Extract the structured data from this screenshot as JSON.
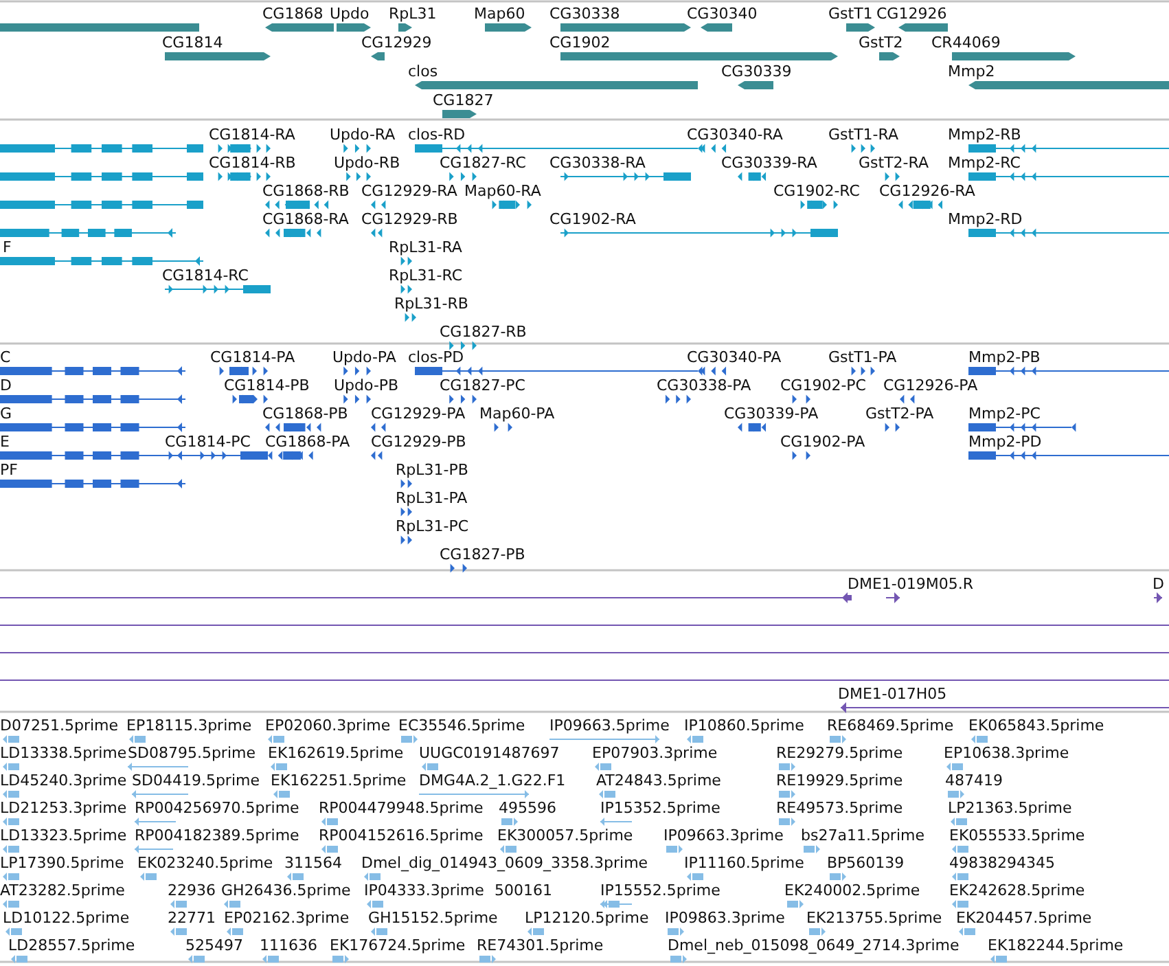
{
  "tracks": [
    {
      "kind": "gene",
      "features": [
        {
          "kind": "partial"
        },
        {
          "label": "CG1868",
          "reverse": true
        },
        {
          "label": "Updo",
          "reverse": false
        },
        {
          "label": "RpL31",
          "reverse": false
        },
        {
          "label": "Map60",
          "reverse": false
        },
        {
          "label": "CG30338",
          "reverse": false
        },
        {
          "label": "CG30340",
          "reverse": true
        },
        {
          "label": "GstT1",
          "reverse": false
        },
        {
          "label": "CG12926",
          "reverse": true
        },
        {
          "label": "CG1814",
          "reverse": false
        },
        {
          "label": "CG12929",
          "reverse": true
        },
        {
          "label": "CG1902",
          "reverse": false
        },
        {
          "label": "GstT2",
          "reverse": false
        },
        {
          "label": "CR44069",
          "reverse": false
        },
        {
          "label": "clos",
          "reverse": true
        },
        {
          "label": "CG30339",
          "reverse": true
        },
        {
          "label": "Mmp2",
          "reverse": true
        },
        {
          "label": "CG1827",
          "reverse": false
        }
      ]
    },
    {
      "kind": "transcript",
      "features": [
        {
          "kind": "partial"
        },
        {
          "label": "CG1814-RA",
          "reverse": false
        },
        {
          "label": "Updo-RA",
          "reverse": false
        },
        {
          "label": "clos-RD",
          "reverse": true
        },
        {
          "label": "CG30340-RA",
          "reverse": true
        },
        {
          "label": "GstT1-RA",
          "reverse": false
        },
        {
          "label": "Mmp2-RB",
          "reverse": true
        },
        {
          "kind": "partial"
        },
        {
          "label": "CG1814-RB",
          "reverse": false
        },
        {
          "label": "Updo-RB",
          "reverse": false
        },
        {
          "label": "CG1827-RC",
          "reverse": false
        },
        {
          "label": "CG30338-RA",
          "reverse": false
        },
        {
          "label": "CG30339-RA",
          "reverse": true
        },
        {
          "label": "GstT2-RA",
          "reverse": false
        },
        {
          "label": "Mmp2-RC",
          "reverse": true
        },
        {
          "kind": "partial"
        },
        {
          "label": "CG1868-RB",
          "reverse": true
        },
        {
          "label": "CG12929-RA",
          "reverse": true
        },
        {
          "label": "Map60-RA",
          "reverse": false
        },
        {
          "label": "CG1902-RC",
          "reverse": false
        },
        {
          "label": "CG12926-RA",
          "reverse": true
        },
        {
          "reverse": true
        },
        {
          "label": "CG1868-RA",
          "reverse": true
        },
        {
          "label": "CG12929-RB",
          "reverse": true
        },
        {
          "label": "CG1902-RA",
          "reverse": false
        },
        {
          "label": "Mmp2-RD",
          "reverse": true
        },
        {
          "label": "F",
          "reverse": true
        },
        {
          "label": "RpL31-RA",
          "reverse": false
        },
        {
          "label": "CG1814-RC",
          "reverse": false
        },
        {
          "label": "RpL31-RC",
          "reverse": false
        },
        {
          "label": "RpL31-RB",
          "reverse": false
        },
        {
          "label": "CG1827-RB",
          "reverse": false
        }
      ]
    },
    {
      "kind": "protein",
      "features": [
        {
          "label": "C",
          "reverse": true
        },
        {
          "label": "CG1814-PA",
          "reverse": false
        },
        {
          "label": "Updo-PA",
          "reverse": false
        },
        {
          "label": "clos-PD",
          "reverse": true
        },
        {
          "label": "CG30340-PA",
          "reverse": true
        },
        {
          "label": "GstT1-PA",
          "reverse": false
        },
        {
          "label": "Mmp2-PB",
          "reverse": true
        },
        {
          "label": "D",
          "reverse": true
        },
        {
          "label": "CG1814-PB",
          "reverse": false
        },
        {
          "label": "Updo-PB",
          "reverse": false
        },
        {
          "label": "CG1827-PC",
          "reverse": false
        },
        {
          "label": "CG30338-PA",
          "reverse": false
        },
        {
          "label": "CG1902-PC",
          "reverse": false
        },
        {
          "label": "CG12926-PA",
          "reverse": true
        },
        {
          "label": "G",
          "reverse": true
        },
        {
          "label": "CG1868-PB",
          "reverse": true
        },
        {
          "label": "CG12929-PA",
          "reverse": true
        },
        {
          "label": "Map60-PA",
          "reverse": false
        },
        {
          "label": "CG30339-PA",
          "reverse": true
        },
        {
          "label": "GstT2-PA",
          "reverse": false
        },
        {
          "label": "Mmp2-PC",
          "reverse": true
        },
        {
          "label": "E",
          "reverse": true
        },
        {
          "label": "CG1814-PC",
          "reverse": false
        },
        {
          "label": "CG1868-PA",
          "reverse": true
        },
        {
          "label": "CG12929-PB",
          "reverse": true
        },
        {
          "label": "CG1902-PA",
          "reverse": false
        },
        {
          "label": "Mmp2-PD",
          "reverse": true
        },
        {
          "label": "PF",
          "reverse": true
        },
        {
          "label": "RpL31-PB",
          "reverse": false
        },
        {
          "label": "RpL31-PA",
          "reverse": false
        },
        {
          "label": "RpL31-PC",
          "reverse": false
        },
        {
          "label": "CG1827-PB",
          "reverse": false
        }
      ]
    },
    {
      "kind": "clone",
      "features": [
        {
          "reverse": true
        },
        {
          "label": "DME1-019M05.R",
          "reverse": false
        },
        {
          "label": "D",
          "reverse": false
        },
        {
          "kind": "line"
        },
        {
          "kind": "line"
        },
        {
          "kind": "line"
        },
        {
          "label": "DME1-017H05",
          "reverse": true
        }
      ]
    },
    {
      "kind": "est",
      "features": [
        {
          "label": "D07251.5prime",
          "reverse": true
        },
        {
          "label": "EP18115.3prime",
          "reverse": true
        },
        {
          "label": "EP02060.3prime",
          "reverse": true
        },
        {
          "label": "EC35546.5prime",
          "reverse": false
        },
        {
          "label": "IP09663.5prime",
          "reverse": false
        },
        {
          "label": "IP10860.5prime",
          "reverse": true
        },
        {
          "label": "RE68469.5prime",
          "reverse": false
        },
        {
          "label": "EK065843.5prime",
          "reverse": true
        },
        {
          "label": "LD13338.5prime",
          "reverse": true
        },
        {
          "label": "SD08795.5prime",
          "reverse": true
        },
        {
          "label": "EK162619.5prime",
          "reverse": true
        },
        {
          "label": "UUGC0191487697",
          "reverse": true
        },
        {
          "label": "EP07903.3prime",
          "reverse": true
        },
        {
          "label": "RE29279.5prime",
          "reverse": false
        },
        {
          "label": "EP10638.3prime",
          "reverse": true
        },
        {
          "label": "LD45240.3prime",
          "reverse": true
        },
        {
          "label": "SD04419.5prime",
          "reverse": true
        },
        {
          "label": "EK162251.5prime",
          "reverse": true
        },
        {
          "label": "DMG4A.2_1.G22.F1",
          "reverse": false
        },
        {
          "label": "AT24843.5prime",
          "reverse": true
        },
        {
          "label": "RE19929.5prime",
          "reverse": false
        },
        {
          "label": "487419",
          "reverse": false
        },
        {
          "label": "LD21253.3prime",
          "reverse": true
        },
        {
          "label": "RP004256970.5prime",
          "reverse": true
        },
        {
          "label": "RP004479948.5prime",
          "reverse": true
        },
        {
          "label": "495596",
          "reverse": false
        },
        {
          "label": "IP15352.5prime",
          "reverse": true
        },
        {
          "label": "RE49573.5prime",
          "reverse": false
        },
        {
          "label": "LP21363.5prime",
          "reverse": true
        },
        {
          "label": "LD13323.5prime",
          "reverse": true
        },
        {
          "label": "RP004182389.5prime",
          "reverse": true
        },
        {
          "label": "RP004152616.5prime",
          "reverse": true
        },
        {
          "label": "EK300057.5prime",
          "reverse": true
        },
        {
          "label": "IP09663.3prime",
          "reverse": false
        },
        {
          "label": "bs27a11.5prime",
          "reverse": false
        },
        {
          "label": "EK055533.5prime",
          "reverse": true
        },
        {
          "label": "LP17390.5prime",
          "reverse": true
        },
        {
          "label": "EK023240.5prime",
          "reverse": true
        },
        {
          "label": "311564",
          "reverse": true
        },
        {
          "label": "Dmel_dig_014943_0609_3358.3prime",
          "reverse": true
        },
        {
          "label": "IP11160.5prime",
          "reverse": true
        },
        {
          "label": "BP560139",
          "reverse": false
        },
        {
          "label": "49838294345",
          "reverse": true
        },
        {
          "label": "AT23282.5prime",
          "reverse": true
        },
        {
          "label": "22936",
          "reverse": true
        },
        {
          "label": "GH26436.5prime",
          "reverse": true
        },
        {
          "label": "IP04333.3prime",
          "reverse": true
        },
        {
          "label": "500161",
          "reverse": true
        },
        {
          "label": "IP15552.5prime",
          "reverse": true
        },
        {
          "label": "EK240002.5prime",
          "reverse": false
        },
        {
          "label": "EK242628.5prime",
          "reverse": true
        },
        {
          "label": "LD10122.5prime",
          "reverse": true
        },
        {
          "label": "22771",
          "reverse": true
        },
        {
          "label": "EP02162.3prime",
          "reverse": true
        },
        {
          "label": "GH15152.5prime",
          "reverse": true
        },
        {
          "label": "LP12120.5prime",
          "reverse": true
        },
        {
          "label": "IP09863.3prime",
          "reverse": false
        },
        {
          "label": "EK213755.5prime",
          "reverse": false
        },
        {
          "label": "EK204457.5prime",
          "reverse": true
        },
        {
          "label": "LD28557.5prime",
          "reverse": true
        },
        {
          "label": "525497",
          "reverse": true
        },
        {
          "label": "111636",
          "reverse": true
        },
        {
          "label": "EK176724.5prime",
          "reverse": false
        },
        {
          "label": "RE74301.5prime",
          "reverse": false
        },
        {
          "label": "Dmel_neb_015098_0649_2714.3prime",
          "reverse": false
        },
        {
          "label": "EK182244.5prime",
          "reverse": true
        }
      ]
    }
  ]
}
